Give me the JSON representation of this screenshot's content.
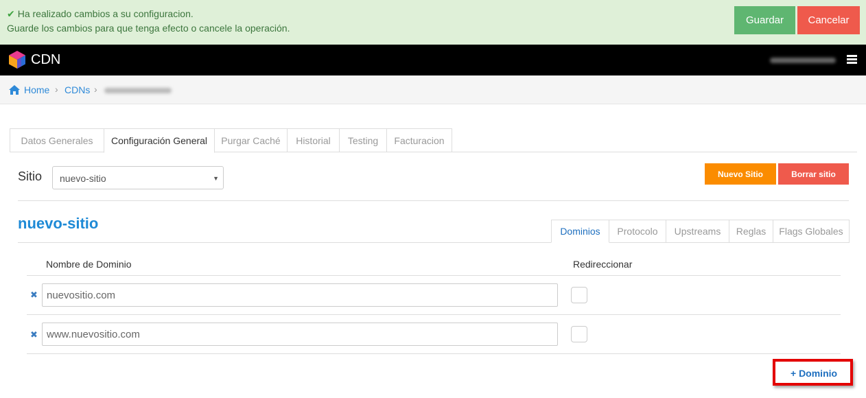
{
  "notice": {
    "line1": "Ha realizado cambios a su configuracion.",
    "line2": "Guarde los cambios para que tenga efecto o cancele la operación.",
    "save_label": "Guardar",
    "cancel_label": "Cancelar"
  },
  "navbar": {
    "brand": "CDN"
  },
  "breadcrumb": {
    "home": "Home",
    "cdns": "CDNs"
  },
  "main_tabs": [
    "Datos Generales",
    "Configuración General",
    "Purgar Caché",
    "Historial",
    "Testing",
    "Facturacion"
  ],
  "sitio": {
    "label": "Sitio",
    "selected": "nuevo-sitio",
    "new_label": "Nuevo Sitio",
    "delete_label": "Borrar sitio"
  },
  "site_title": "nuevo-sitio",
  "sub_tabs": [
    "Dominios",
    "Protocolo",
    "Upstreams",
    "Reglas",
    "Flags Globales"
  ],
  "table": {
    "col_domain": "Nombre de Dominio",
    "col_redirect": "Redireccionar",
    "rows": [
      {
        "domain": "nuevositio.com"
      },
      {
        "domain": "www.nuevositio.com"
      }
    ]
  },
  "add_domain_label": "+ Dominio",
  "colors": {
    "accent": "#1e8ad6",
    "success": "#5fb671",
    "danger": "#ef5a4c",
    "warning": "#fb8c00"
  }
}
